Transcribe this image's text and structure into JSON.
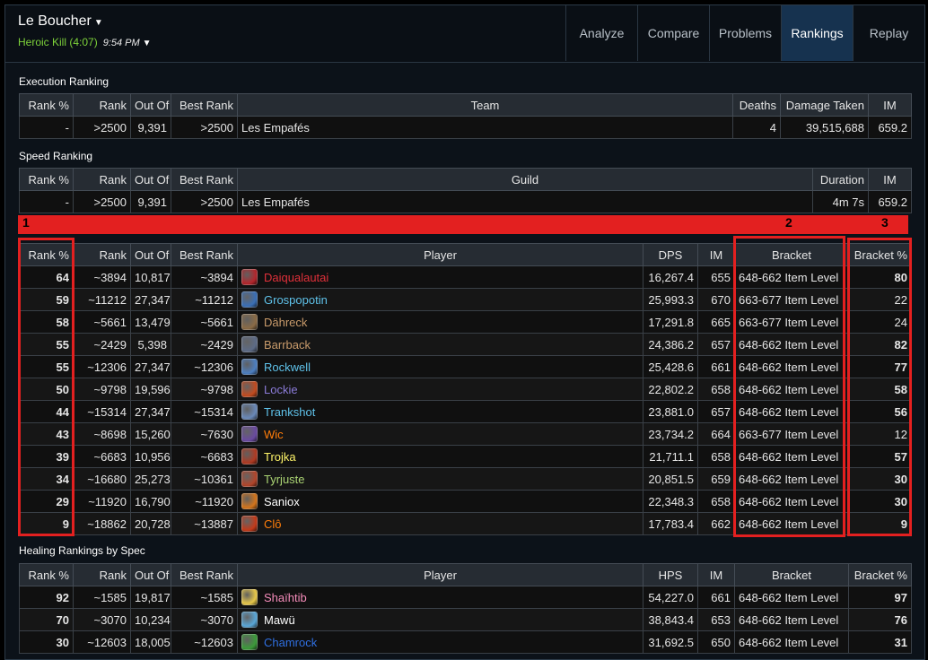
{
  "header": {
    "boss_name": "Le Boucher",
    "kill_label": "Heroic Kill (4:07)",
    "kill_time": "9:54 PM",
    "tabs": [
      {
        "label": "Analyze",
        "active": false
      },
      {
        "label": "Compare",
        "active": false
      },
      {
        "label": "Problems",
        "active": false
      },
      {
        "label": "Rankings",
        "active": true
      },
      {
        "label": "Replay",
        "active": false
      }
    ]
  },
  "execution": {
    "title": "Execution Ranking",
    "headers": [
      "Rank %",
      "Rank",
      "Out Of",
      "Best Rank",
      "Team",
      "Deaths",
      "Damage Taken",
      "IM"
    ],
    "row": {
      "rank_pct": "-",
      "rank": ">2500",
      "out_of": "9,391",
      "best_rank": ">2500",
      "team": "Les Empafés",
      "deaths": "4",
      "damage_taken": "39,515,688",
      "im": "659.2"
    }
  },
  "speed": {
    "title": "Speed Ranking",
    "headers": [
      "Rank %",
      "Rank",
      "Out Of",
      "Best Rank",
      "Guild",
      "Duration",
      "IM"
    ],
    "row": {
      "rank_pct": "-",
      "rank": ">2500",
      "out_of": "9,391",
      "best_rank": ">2500",
      "guild": "Les Empafés",
      "duration": "4m 7s",
      "im": "659.2"
    }
  },
  "annotations": {
    "labels": [
      "1",
      "2",
      "3"
    ],
    "color": "#e32020"
  },
  "dps": {
    "headers": [
      "Rank %",
      "Rank",
      "Out Of",
      "Best Rank",
      "Player",
      "DPS",
      "IM",
      "Bracket",
      "Bracket %"
    ],
    "rows": [
      {
        "rank_pct": "64",
        "rank_cls": "rank-blue",
        "rank": "~3894",
        "out_of": "10,817",
        "best_rank": "~3894",
        "icon": "death-knight-icon",
        "icon_color": "#b3262c",
        "player": "Daiqualautai",
        "player_color": "#e0303a",
        "dps": "16,267.4",
        "im": "655",
        "bracket": "648-662 Item Level",
        "bracket_pct": "80",
        "bracket_cls": "rank-purple"
      },
      {
        "rank_pct": "59",
        "rank_cls": "rank-blue",
        "rank": "~11212",
        "out_of": "27,347",
        "best_rank": "~11212",
        "icon": "frost-mage-icon",
        "icon_color": "#3a6fb6",
        "player": "Grospopotin",
        "player_color": "#5fc2ea",
        "dps": "25,993.3",
        "im": "670",
        "bracket": "663-677 Item Level",
        "bracket_pct": "22",
        "bracket_cls": "rank-dim"
      },
      {
        "rank_pct": "58",
        "rank_cls": "rank-blue",
        "rank": "~5661",
        "out_of": "13,479",
        "best_rank": "~5661",
        "icon": "warrior-icon",
        "icon_color": "#8a6b46",
        "player": "Dähreck",
        "player_color": "#c99b6b",
        "dps": "17,291.8",
        "im": "665",
        "bracket": "663-677 Item Level",
        "bracket_pct": "24",
        "bracket_cls": "rank-dim"
      },
      {
        "rank_pct": "55",
        "rank_cls": "rank-blue",
        "rank": "~2429",
        "out_of": "5,398",
        "best_rank": "~2429",
        "icon": "warrior-icon",
        "icon_color": "#5d6b86",
        "player": "Barrback",
        "player_color": "#c99b6b",
        "dps": "24,386.2",
        "im": "657",
        "bracket": "648-662 Item Level",
        "bracket_pct": "82",
        "bracket_cls": "rank-purple"
      },
      {
        "rank_pct": "55",
        "rank_cls": "rank-blue",
        "rank": "~12306",
        "out_of": "27,347",
        "best_rank": "~12306",
        "icon": "frost-mage-icon",
        "icon_color": "#4d7fc0",
        "player": "Rockwell",
        "player_color": "#5fc2ea",
        "dps": "25,428.6",
        "im": "661",
        "bracket": "648-662 Item Level",
        "bracket_pct": "77",
        "bracket_cls": "rank-purple"
      },
      {
        "rank_pct": "50",
        "rank_cls": "rank-blue",
        "rank": "~9798",
        "out_of": "19,596",
        "best_rank": "~9798",
        "icon": "warlock-icon",
        "icon_color": "#c24b1f",
        "player": "Lockie",
        "player_color": "#8b7bd8",
        "dps": "22,802.2",
        "im": "658",
        "bracket": "648-662 Item Level",
        "bracket_pct": "58",
        "bracket_cls": "rank-blue"
      },
      {
        "rank_pct": "44",
        "rank_cls": "rank-green",
        "rank": "~15314",
        "out_of": "27,347",
        "best_rank": "~15314",
        "icon": "frost-mage-icon",
        "icon_color": "#6a89b8",
        "player": "Trankshot",
        "player_color": "#5fc2ea",
        "dps": "23,881.0",
        "im": "657",
        "bracket": "648-662 Item Level",
        "bracket_pct": "56",
        "bracket_cls": "rank-blue"
      },
      {
        "rank_pct": "43",
        "rank_cls": "rank-green",
        "rank": "~8698",
        "out_of": "15,260",
        "best_rank": "~7630",
        "icon": "balance-druid-icon",
        "icon_color": "#6a4aa0",
        "player": "Wic",
        "player_color": "#ff7d0a",
        "dps": "23,734.2",
        "im": "664",
        "bracket": "663-677 Item Level",
        "bracket_pct": "12",
        "bracket_cls": "rank-dim"
      },
      {
        "rank_pct": "39",
        "rank_cls": "rank-green",
        "rank": "~6683",
        "out_of": "10,956",
        "best_rank": "~6683",
        "icon": "rogue-icon",
        "icon_color": "#b03a22",
        "player": "Trojka",
        "player_color": "#fff569",
        "dps": "21,711.1",
        "im": "658",
        "bracket": "648-662 Item Level",
        "bracket_pct": "57",
        "bracket_cls": "rank-blue"
      },
      {
        "rank_pct": "34",
        "rank_cls": "rank-green",
        "rank": "~16680",
        "out_of": "25,273",
        "best_rank": "~10361",
        "icon": "hunter-icon",
        "icon_color": "#b2452a",
        "player": "Tyrjuste",
        "player_color": "#abd473",
        "dps": "20,851.5",
        "im": "659",
        "bracket": "648-662 Item Level",
        "bracket_pct": "30",
        "bracket_cls": "rank-green"
      },
      {
        "rank_pct": "29",
        "rank_cls": "rank-green",
        "rank": "~11920",
        "out_of": "16,790",
        "best_rank": "~11920",
        "icon": "priest-icon",
        "icon_color": "#d3751c",
        "player": "Saniox",
        "player_color": "#ffffff",
        "dps": "22,348.3",
        "im": "658",
        "bracket": "648-662 Item Level",
        "bracket_pct": "30",
        "bracket_cls": "rank-green"
      },
      {
        "rank_pct": "9",
        "rank_cls": "rank-gray",
        "rank": "~18862",
        "out_of": "20,728",
        "best_rank": "~13887",
        "icon": "feral-druid-icon",
        "icon_color": "#c23a1a",
        "player": "Clô",
        "player_color": "#ff7d0a",
        "dps": "17,783.4",
        "im": "662",
        "bracket": "648-662 Item Level",
        "bracket_pct": "9",
        "bracket_cls": "rank-gray"
      }
    ]
  },
  "healing": {
    "title": "Healing Rankings by Spec",
    "headers": [
      "Rank %",
      "Rank",
      "Out Of",
      "Best Rank",
      "Player",
      "HPS",
      "IM",
      "Bracket",
      "Bracket %"
    ],
    "rows": [
      {
        "rank_pct": "92",
        "rank_cls": "rank-purple",
        "rank": "~1585",
        "out_of": "19,817",
        "best_rank": "~1585",
        "icon": "holy-paladin-icon",
        "icon_color": "#e6c74a",
        "player": "Shaïhtib",
        "player_color": "#f58cba",
        "hps": "54,227.0",
        "im": "661",
        "bracket": "648-662 Item Level",
        "bracket_pct": "97",
        "bracket_cls": "rank-orange"
      },
      {
        "rank_pct": "70",
        "rank_cls": "rank-blue",
        "rank": "~3070",
        "out_of": "10,234",
        "best_rank": "~3070",
        "icon": "disc-priest-icon",
        "icon_color": "#5aa6d6",
        "player": "Mawü",
        "player_color": "#ffffff",
        "hps": "38,843.4",
        "im": "653",
        "bracket": "648-662 Item Level",
        "bracket_pct": "76",
        "bracket_cls": "rank-purple"
      },
      {
        "rank_pct": "30",
        "rank_cls": "rank-green",
        "rank": "~12603",
        "out_of": "18,005",
        "best_rank": "~12603",
        "icon": "resto-shaman-icon",
        "icon_color": "#3c9a3a",
        "player": "Chamrock",
        "player_color": "#2f6fe0",
        "hps": "31,692.5",
        "im": "650",
        "bracket": "648-662 Item Level",
        "bracket_pct": "31",
        "bracket_cls": "rank-green"
      }
    ]
  }
}
